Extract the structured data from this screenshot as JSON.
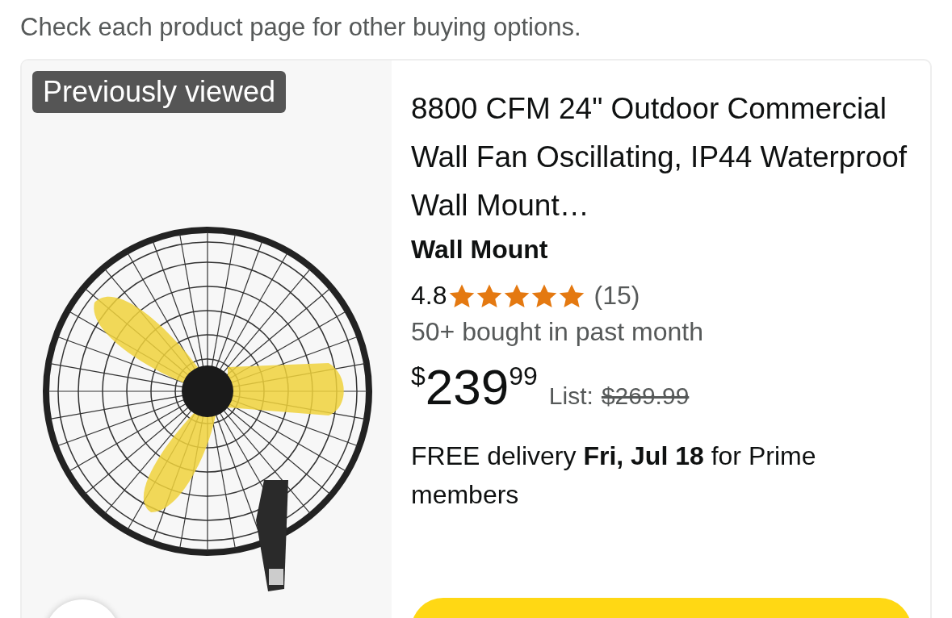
{
  "notice": "Check each product page for other buying options.",
  "product": {
    "badge": "Previously viewed",
    "title": "8800 CFM 24\" Outdoor Commercial Wall Fan Oscillating, IP44 Waterproof Wall Mount…",
    "variant": "Wall Mount",
    "rating": "4.8",
    "stars": 5,
    "review_count": "(15)",
    "bought": "50+ bought in past month",
    "price": {
      "symbol": "$",
      "whole": "239",
      "fraction": "99"
    },
    "list_label": "List:",
    "list_price": "$269.99",
    "delivery": "FREE delivery **Fri, Jul 18** for Prime members"
  }
}
